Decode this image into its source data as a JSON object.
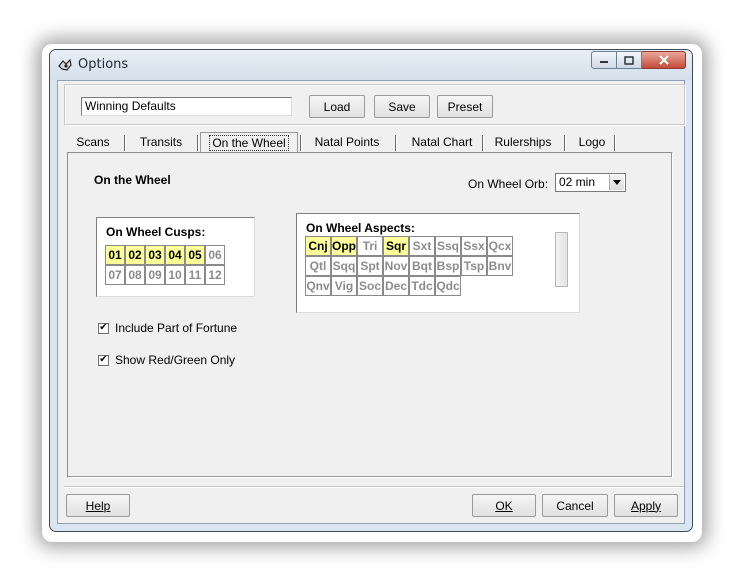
{
  "window": {
    "title": "Options"
  },
  "top": {
    "preset_value": "Winning Defaults",
    "load_label": "Load",
    "save_label": "Save",
    "preset_label": "Preset"
  },
  "tabs": [
    "Scans",
    "Transits",
    "On the Wheel",
    "Natal Points",
    "Natal Chart",
    "Rulerships",
    "Logo"
  ],
  "active_tab": "On the Wheel",
  "panel": {
    "title": "On the Wheel",
    "orb_label": "On Wheel Orb:",
    "orb_value": "02 min",
    "cusps": {
      "title": "On Wheel Cusps:",
      "items": [
        {
          "label": "01",
          "on": true
        },
        {
          "label": "02",
          "on": true
        },
        {
          "label": "03",
          "on": true
        },
        {
          "label": "04",
          "on": true
        },
        {
          "label": "05",
          "on": true
        },
        {
          "label": "06",
          "on": false
        },
        {
          "label": "07",
          "on": false
        },
        {
          "label": "08",
          "on": false
        },
        {
          "label": "09",
          "on": false
        },
        {
          "label": "10",
          "on": false
        },
        {
          "label": "11",
          "on": false
        },
        {
          "label": "12",
          "on": false
        }
      ]
    },
    "aspects": {
      "title": "On Wheel Aspects:",
      "items": [
        {
          "label": "Cnj",
          "on": true
        },
        {
          "label": "Opp",
          "on": true
        },
        {
          "label": "Tri",
          "on": false
        },
        {
          "label": "Sqr",
          "on": true
        },
        {
          "label": "Sxt",
          "on": false
        },
        {
          "label": "Ssq",
          "on": false
        },
        {
          "label": "Ssx",
          "on": false
        },
        {
          "label": "Qcx",
          "on": false
        },
        {
          "label": "Qtl",
          "on": false
        },
        {
          "label": "Sqq",
          "on": false
        },
        {
          "label": "Spt",
          "on": false
        },
        {
          "label": "Nov",
          "on": false
        },
        {
          "label": "Bqt",
          "on": false
        },
        {
          "label": "Bsp",
          "on": false
        },
        {
          "label": "Tsp",
          "on": false
        },
        {
          "label": "Bnv",
          "on": false
        },
        {
          "label": "Qnv",
          "on": false
        },
        {
          "label": "Vig",
          "on": false
        },
        {
          "label": "Soc",
          "on": false
        },
        {
          "label": "Dec",
          "on": false
        },
        {
          "label": "Tdc",
          "on": false
        },
        {
          "label": "Qdc",
          "on": false
        }
      ]
    },
    "include_pof": {
      "label": "Include Part of Fortune",
      "checked": true
    },
    "red_green": {
      "label": "Show Red/Green Only",
      "checked": true
    }
  },
  "footer": {
    "help_label": "Help",
    "ok_label": "OK",
    "cancel_label": "Cancel",
    "apply_label": "Apply"
  },
  "colors": {
    "highlight": "#ffff99",
    "face": "#f0f0f0"
  }
}
